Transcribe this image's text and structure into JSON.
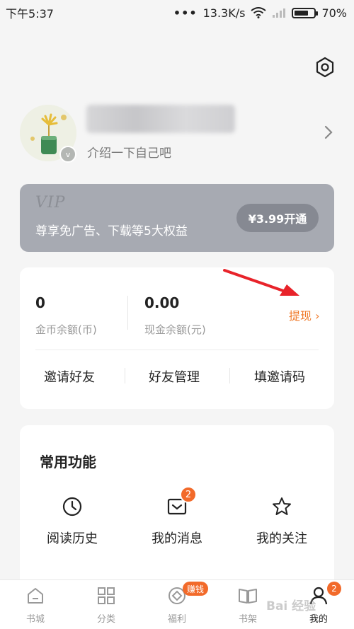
{
  "status_bar": {
    "time": "下午5:37",
    "network_speed": "13.3K/s",
    "battery": "70%",
    "battery_level": 0.7
  },
  "profile": {
    "intro": "介绍一下自己吧",
    "badge_letter": "v"
  },
  "vip": {
    "title": "VIP",
    "description": "尊享免广告、下载等5大权益",
    "button": "¥3.99开通"
  },
  "balance": {
    "coins_value": "0",
    "coins_label": "金币余额(币)",
    "cash_value": "0.00",
    "cash_label": "现金余额(元)",
    "withdraw": "提现 ›"
  },
  "actions": [
    "邀请好友",
    "好友管理",
    "填邀请码"
  ],
  "functions": {
    "title": "常用功能",
    "items": [
      {
        "label": "阅读历史",
        "icon": "clock-icon"
      },
      {
        "label": "我的消息",
        "icon": "message-icon",
        "badge": "2"
      },
      {
        "label": "我的关注",
        "icon": "star-icon"
      }
    ]
  },
  "nav": {
    "items": [
      {
        "label": "书城",
        "icon": "home-icon"
      },
      {
        "label": "分类",
        "icon": "grid-icon"
      },
      {
        "label": "福利",
        "icon": "coin-icon",
        "pill": "赚钱"
      },
      {
        "label": "书架",
        "icon": "book-icon"
      },
      {
        "label": "我的",
        "icon": "person-icon",
        "badge": "2",
        "active": true
      }
    ]
  },
  "colors": {
    "accent": "#f26a2a",
    "vip_bg": "#a7aab2",
    "annotation_arrow": "#e8232a"
  }
}
